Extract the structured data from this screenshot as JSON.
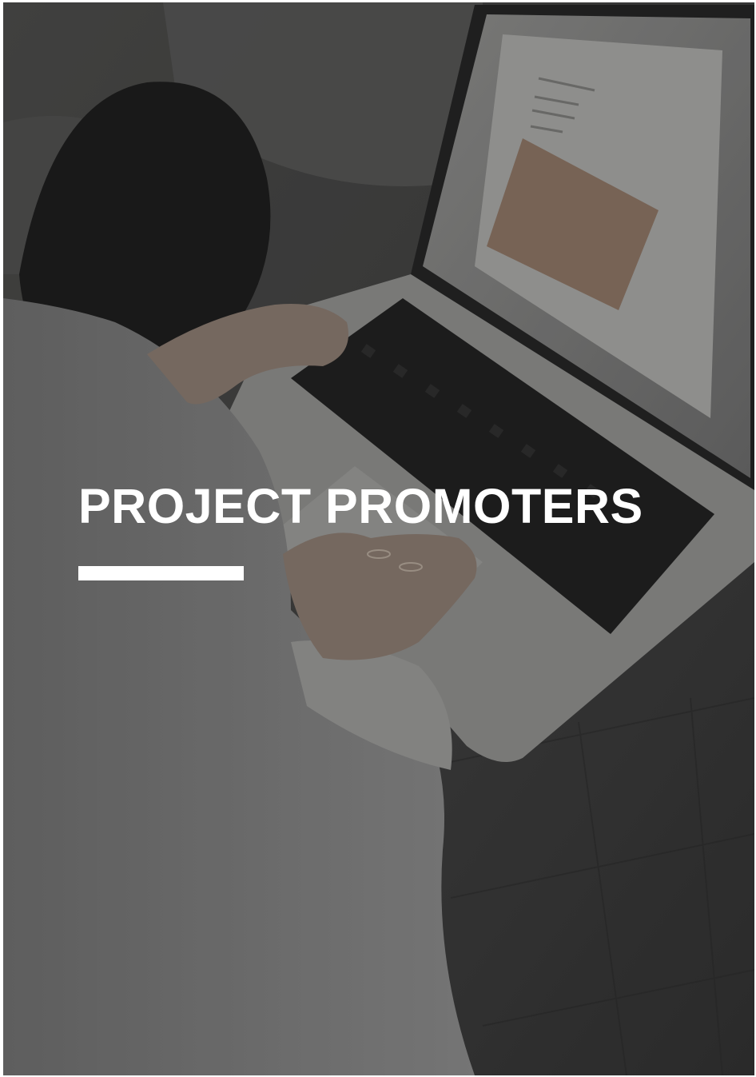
{
  "cover": {
    "title": "PROJECT PROMOTERS",
    "accent_color": "#ffffff",
    "background_image": "person-typing-on-laptop-photo"
  }
}
